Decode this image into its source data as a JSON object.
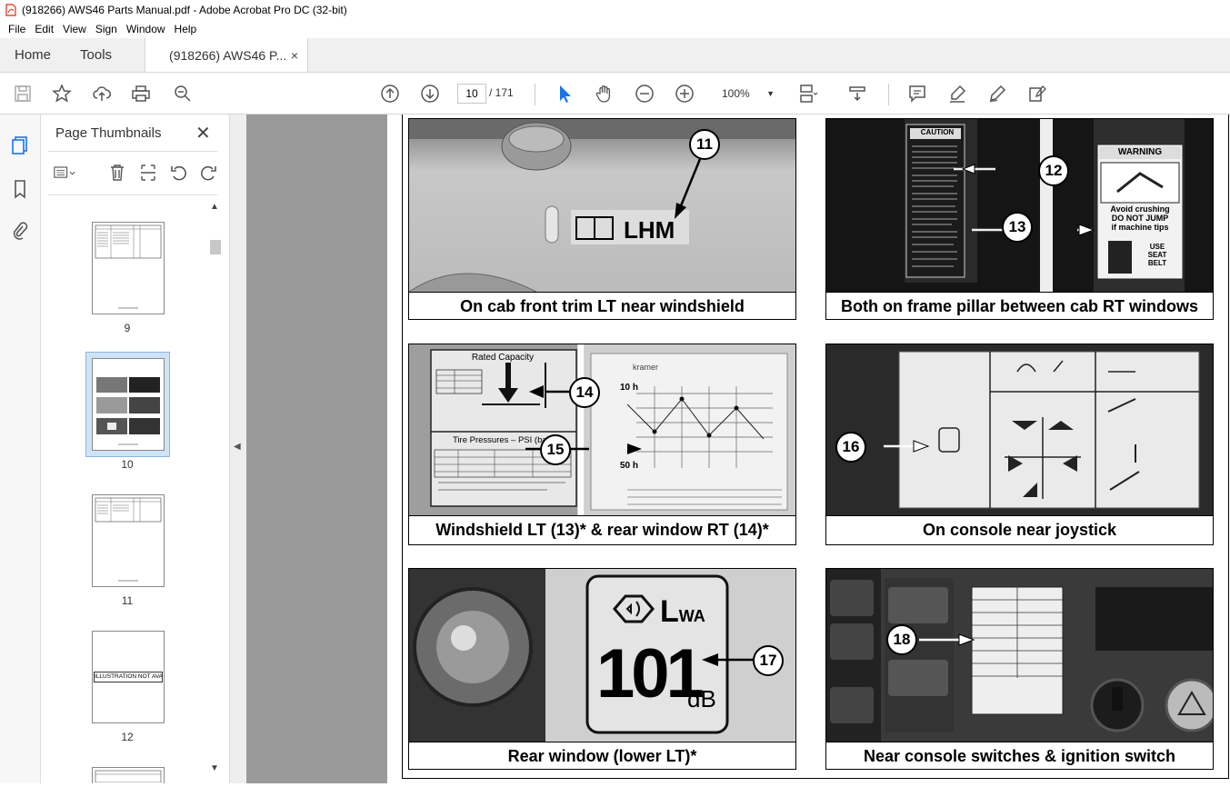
{
  "window": {
    "title": "(918266) AWS46 Parts Manual.pdf - Adobe Acrobat Pro DC (32-bit)"
  },
  "menu": [
    "File",
    "Edit",
    "View",
    "Sign",
    "Window",
    "Help"
  ],
  "tabs": {
    "home": "Home",
    "tools": "Tools",
    "doc": "(918266) AWS46 P...",
    "close": "×"
  },
  "toolbar": {
    "page_current": "10",
    "page_total": "/ 171",
    "zoom": "100%"
  },
  "thumbnails": {
    "title": "Page Thumbnails",
    "close": "✕",
    "pages": [
      {
        "label": "9"
      },
      {
        "label": "10"
      },
      {
        "label": "11"
      },
      {
        "label": "12",
        "text": "ILLUSTRATION NOT AVAILABLE"
      }
    ]
  },
  "figures": [
    {
      "caption": "On cab front trim LT near windshield",
      "callouts": [
        "11"
      ],
      "decal_text": "LHM"
    },
    {
      "caption": "Both on frame pillar between cab RT windows",
      "callouts": [
        "12",
        "13"
      ],
      "decal_text": [
        "CAUTION",
        "WARNING",
        "Avoid crushing",
        "DO NOT JUMP",
        "if machine tips",
        "USE",
        "SEAT",
        "BELT"
      ]
    },
    {
      "caption": "Windshield LT (13)* & rear window RT (14)*",
      "callouts": [
        "14",
        "15"
      ],
      "decal_text": [
        "Rated Capacity",
        "Tire Pressures – PSI (bar)",
        "10 h",
        "50 h",
        "kramer"
      ]
    },
    {
      "caption": "On console near joystick",
      "callouts": [
        "16"
      ]
    },
    {
      "caption": "Rear window (lower LT)*",
      "callouts": [
        "17"
      ],
      "decal_text": [
        "L",
        "WA",
        "101",
        "dB"
      ]
    },
    {
      "caption": "Near console switches & ignition switch",
      "callouts": [
        "18"
      ]
    }
  ],
  "colors": {
    "accent": "#e0281a",
    "toolbar_icon": "#555555",
    "viewer_bg": "#9a9a9a"
  }
}
